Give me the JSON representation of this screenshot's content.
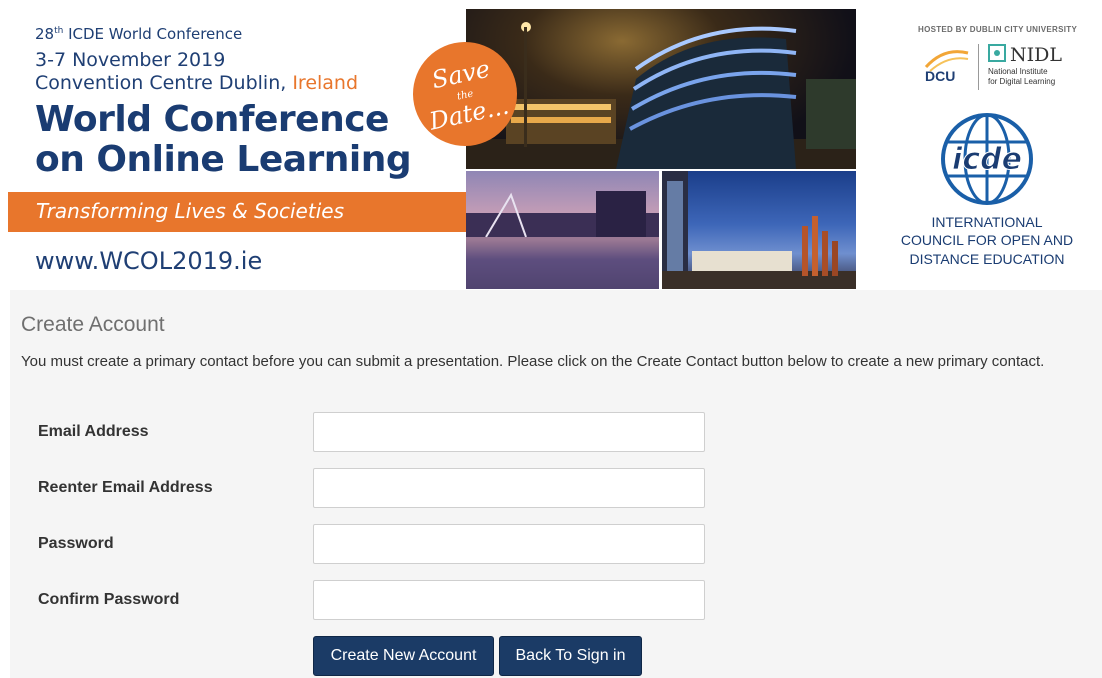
{
  "banner": {
    "conference_number": "28",
    "conference_number_suffix": "th",
    "conference_name": " ICDE World Conference",
    "dates": "3-7 November 2019",
    "venue": "Convention Centre Dublin, ",
    "venue_country": "Ireland",
    "title_line1": "World Conference",
    "title_line2": "on Online Learning",
    "tagline": "Transforming Lives & Societies",
    "website": "www.WCOL2019.ie",
    "save_date_line1": "Save",
    "save_date_line2": "the",
    "save_date_line3": "Date...",
    "hosted_by": "HOSTED BY DUBLIN CITY UNIVERSITY",
    "dcu_logo_text": "DCU",
    "nidl_logo_text": "NIDL",
    "nidl_sub1": "National Institute",
    "nidl_sub2": "for Digital Learning",
    "icde_logo_text": "icde",
    "icde_line1": "INTERNATIONAL",
    "icde_line2": "COUNCIL FOR OPEN AND",
    "icde_line3": "DISTANCE EDUCATION",
    "colors": {
      "navy": "#1a3c72",
      "orange": "#e8762c"
    }
  },
  "form": {
    "title": "Create Account",
    "description": "You must create a primary contact before you can submit a presentation. Please click on the Create Contact button below to create a new primary contact.",
    "fields": [
      {
        "label": "Email Address",
        "value": "",
        "placeholder": ""
      },
      {
        "label": "Reenter Email Address",
        "value": "",
        "placeholder": ""
      },
      {
        "label": "Password",
        "value": "",
        "placeholder": ""
      },
      {
        "label": "Confirm Password",
        "value": "",
        "placeholder": ""
      }
    ],
    "buttons": {
      "create": "Create New Account",
      "back": "Back To Sign in"
    },
    "colors": {
      "button_bg": "#1b3b66",
      "panel_bg": "#f5f5f5"
    }
  }
}
